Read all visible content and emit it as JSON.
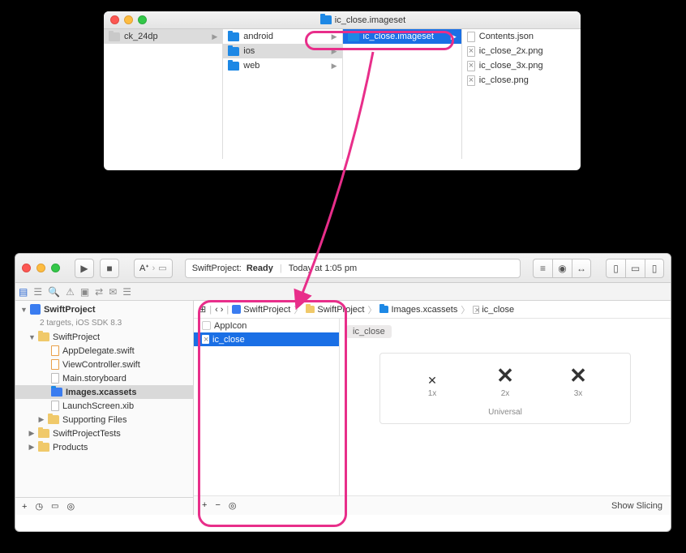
{
  "finder": {
    "title": "ic_close.imageset",
    "col1": [
      {
        "label": "ck_24dp",
        "type": "folder-grey",
        "selected": "grey"
      }
    ],
    "col2": [
      {
        "label": "android",
        "type": "folder",
        "selected": "none"
      },
      {
        "label": "ios",
        "type": "folder",
        "selected": "grey"
      },
      {
        "label": "web",
        "type": "folder",
        "selected": "none"
      }
    ],
    "col3": [
      {
        "label": "ic_close.imageset",
        "type": "folder",
        "selected": "blue"
      }
    ],
    "col4": [
      {
        "label": "Contents.json",
        "type": "file-json"
      },
      {
        "label": "ic_close_2x.png",
        "type": "file-x"
      },
      {
        "label": "ic_close_3x.png",
        "type": "file-x"
      },
      {
        "label": "ic_close.png",
        "type": "file-x"
      }
    ]
  },
  "xcode": {
    "status_project": "SwiftProject:",
    "status_state": "Ready",
    "status_time": "Today at 1:05 pm",
    "nav_tabs": [
      "folder",
      "tree",
      "search",
      "warning",
      "bug",
      "arrows",
      "speech",
      "report"
    ],
    "project": {
      "name": "SwiftProject",
      "subtitle": "2 targets, iOS SDK 8.3",
      "groups": [
        {
          "label": "SwiftProject",
          "children": [
            {
              "label": "AppDelegate.swift",
              "icon": "swift"
            },
            {
              "label": "ViewController.swift",
              "icon": "swift"
            },
            {
              "label": "Main.storyboard",
              "icon": "storyboard"
            },
            {
              "label": "Images.xcassets",
              "icon": "xcassets",
              "selected": true
            },
            {
              "label": "LaunchScreen.xib",
              "icon": "xib"
            },
            {
              "label": "Supporting Files",
              "icon": "folder"
            }
          ]
        },
        {
          "label": "SwiftProjectTests",
          "children": []
        },
        {
          "label": "Products",
          "children": []
        }
      ]
    },
    "breadcrumbs": [
      "SwiftProject",
      "SwiftProject",
      "Images.xcassets",
      "ic_close"
    ],
    "assets": [
      {
        "label": "AppIcon",
        "selected": false
      },
      {
        "label": "ic_close",
        "selected": true
      }
    ],
    "asset_detail": {
      "name": "ic_close",
      "slots": [
        {
          "scale": "1x",
          "size": 14
        },
        {
          "scale": "2x",
          "size": 26
        },
        {
          "scale": "3x",
          "size": 26
        }
      ],
      "idiom": "Universal"
    },
    "footer": {
      "show_slicing": "Show Slicing"
    }
  }
}
